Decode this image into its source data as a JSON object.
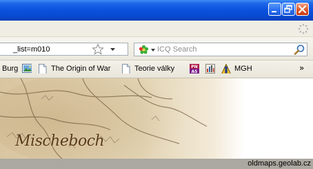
{
  "window": {
    "buttons": {
      "minimize": "minimize",
      "maximize": "maximize",
      "close": "close"
    }
  },
  "navbar": {
    "url_text": "_list=m010",
    "search": {
      "placeholder": "ICQ Search",
      "engine_icon": "icq-flower-icon"
    }
  },
  "bookmarks": [
    {
      "label": "Burg",
      "icon": "picture-icon"
    },
    {
      "label": "The Origin of War",
      "icon": "page-icon"
    },
    {
      "label": "Teorie války",
      "icon": "page-icon"
    },
    {
      "label": "",
      "icon": "pn-as-icon"
    },
    {
      "label": "",
      "icon": "chart-icon"
    },
    {
      "label": "MGH",
      "icon": "person-icon"
    }
  ],
  "bookmarks_overflow": "»",
  "content": {
    "map_text": "Mischeboch"
  },
  "status": {
    "domain": "oldmaps.geolab.cz"
  }
}
